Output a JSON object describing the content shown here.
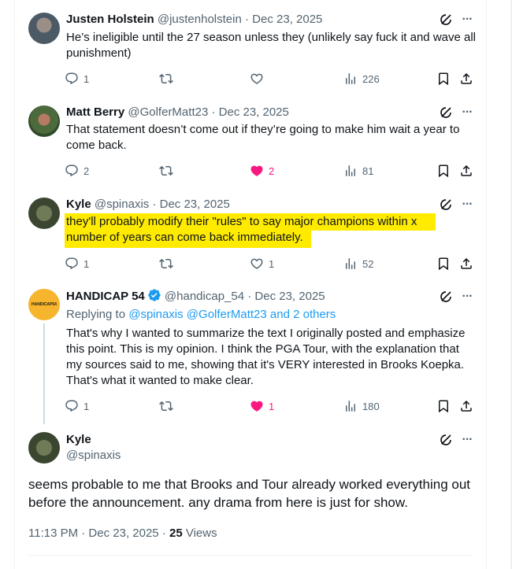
{
  "replies": [
    {
      "name": "Justen Holstein",
      "handle": "@justenholstein",
      "sep": " · ",
      "date": "Dec 23, 2025",
      "text": "He’s ineligible until the 27 season unless they (unlikely say fuck it and wave all punishment)",
      "replies": "1",
      "retweets": "",
      "likes": "",
      "liked": false,
      "views": "226"
    },
    {
      "name": "Matt Berry",
      "handle": "@GolferMatt23",
      "sep": " · ",
      "date": "Dec 23, 2025",
      "text": "That statement doesn’t come out if they’re going to make him wait a year to come back.",
      "replies": "2",
      "retweets": "",
      "likes": "2",
      "liked": true,
      "views": "81"
    },
    {
      "name": "Kyle",
      "handle": "@spinaxis",
      "sep": " · ",
      "date": "Dec 23, 2025",
      "text_line1": "they'll probably modify their \"rules\" to say major champions within x",
      "text_line2": "number of years can come back immediately.",
      "replies": "1",
      "retweets": "",
      "likes": "1",
      "liked": false,
      "views": "52"
    },
    {
      "name": "HANDICAP 54",
      "handle": "@handicap_54",
      "sep": " · ",
      "date": "Dec 23, 2025",
      "replying_prefix": "Replying to ",
      "replying_mentions": "@spinaxis @GolferMatt23 and 2 others",
      "text": "That's why I wanted to summarize the text I originally posted and emphasize this point. This is my opinion. I think the PGA Tour, with the explanation that my sources said to me, showing that it's VERY interested in Brooks Koepka. That's what it wanted to make clear.",
      "replies": "1",
      "retweets": "",
      "likes": "1",
      "liked": true,
      "views": "180",
      "avatar_text": "HANDICAP54"
    }
  ],
  "main": {
    "name": "Kyle",
    "handle": "@spinaxis",
    "text": "seems probable to me that Brooks and Tour already worked everything out before the announcement. any drama from here is just for show.",
    "time": "11:13 PM · Dec 23, 2025 · ",
    "views_count": "25",
    "views_label": " Views"
  },
  "colors": {
    "accent": "#1d9bf0",
    "like": "#f91880",
    "highlight": "#ffeb00",
    "secondary_text": "#536471"
  },
  "icons": [
    "reply-icon",
    "retweet-icon",
    "like-icon",
    "views-icon",
    "bookmark-icon",
    "share-icon",
    "grok-icon",
    "more-icon",
    "verified-badge-icon"
  ]
}
